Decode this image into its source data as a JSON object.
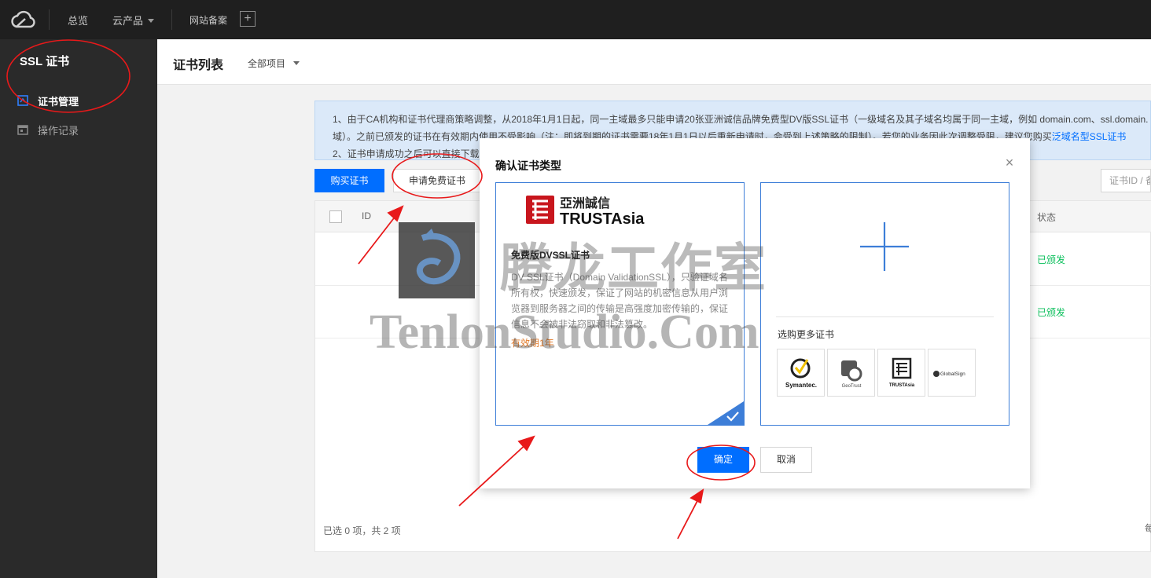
{
  "topbar": {
    "overview": "总览",
    "products": "云产品",
    "icp": "网站备案",
    "add": "+"
  },
  "sidebar": {
    "title": "SSL 证书",
    "items": [
      {
        "label": "证书管理",
        "icon": "certificate-icon",
        "active": true
      },
      {
        "label": "操作记录",
        "icon": "calendar-icon",
        "active": false
      }
    ]
  },
  "header": {
    "title": "证书列表",
    "project": "全部项目"
  },
  "notice": {
    "line1": "1、由于CA机构和证书代理商策略调整，从2018年1月1日起，同一主域最多只能申请20张亚洲诚信品牌免费型DV版SSL证书（一级域名及其子域名均属于同一主域，例如 domain.com、ssl.domain.",
    "line2_pre": "域）。之前已颁发的证书在有效期内使用不受影响（注：即将到期的证书需要18年1月1日以后重新申请时，会受到上述策略的限制）。若您的业务因此次调整受限，建议您购买",
    "line2_link": "泛域名型SSL证书",
    "line3": "2、证书申请成功之后可以直接下载"
  },
  "toolbar": {
    "buy": "购买证书",
    "free": "申请免费证书",
    "search_placeholder": "证书ID / 备"
  },
  "table": {
    "columns": {
      "id": "ID",
      "status": "状态"
    },
    "rows": [
      {
        "status": "已颁发"
      },
      {
        "status": "已颁发"
      }
    ],
    "footer": "已选 0 项，共 2 项",
    "per_page": "每"
  },
  "dialog": {
    "title": "确认证书类型",
    "close": "×",
    "free_card": {
      "logo_cn": "亞洲誠信",
      "logo_en": "TRUSTAsia",
      "name": "免费版DVSSL证书",
      "desc": "DV SSL证书（Domain ValidationSSL），只验证域名所有权，快速颁发，保证了网站的机密信息从用户浏览器到服务器之间的传输是高强度加密传输的，保证信息不会被非法窃取和非法篡改。",
      "validity": "有效期1年"
    },
    "more_card": {
      "label": "选购更多证书",
      "brands": [
        "Symantec.",
        "GeoTrust",
        "TRUSTAsia",
        "GlobalSign"
      ]
    },
    "ok": "确定",
    "cancel": "取消"
  },
  "watermark": {
    "cn": "腾龙工作室",
    "en": "TenlonStudio.Com"
  },
  "colors": {
    "primary": "#006eff",
    "success": "#0abf5b",
    "annotation": "#e8191a",
    "validity": "#e17b2b"
  }
}
